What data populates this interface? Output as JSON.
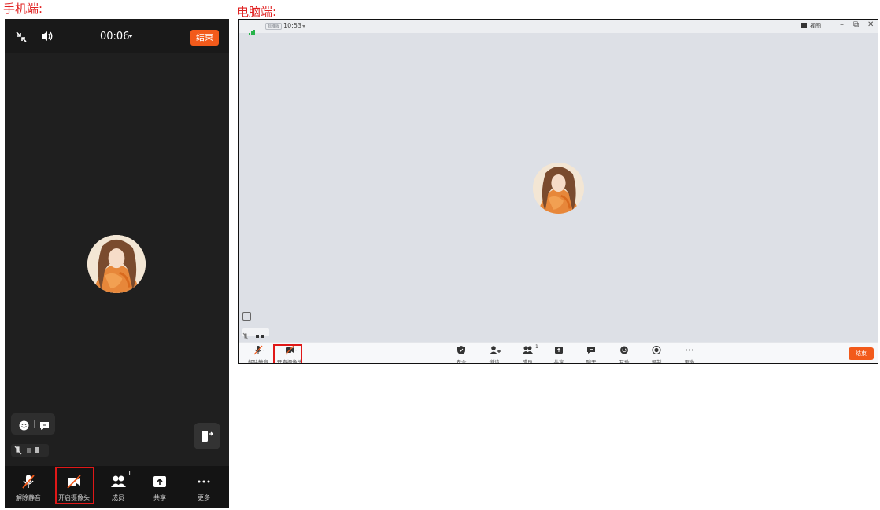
{
  "labels": {
    "mobile": "手机端:",
    "pc": "电脑端:"
  },
  "mobile": {
    "timer": "00:06",
    "end_button": "结束",
    "toolbar": [
      {
        "icon": "mic-muted-icon",
        "label": "解除静音"
      },
      {
        "icon": "camera-off-icon",
        "label": "开启摄像头",
        "highlighted": true
      },
      {
        "icon": "members-icon",
        "label": "成员",
        "badge": "1"
      },
      {
        "icon": "share-icon",
        "label": "共享"
      },
      {
        "icon": "more-icon",
        "label": "更多"
      }
    ]
  },
  "pc": {
    "badge": "标准版",
    "time": "10:53",
    "view_label": "视图",
    "end_button": "结束",
    "toolbar_left": [
      {
        "icon": "mic-muted-icon",
        "label": "解除静音"
      },
      {
        "icon": "camera-off-icon",
        "label": "开启摄像头",
        "highlighted": true
      }
    ],
    "toolbar_center": [
      {
        "icon": "security-icon",
        "label": "安全"
      },
      {
        "icon": "invite-icon",
        "label": "邀请"
      },
      {
        "icon": "members-icon",
        "label": "成员",
        "badge": "1"
      },
      {
        "icon": "share-icon",
        "label": "共享"
      },
      {
        "icon": "chat-icon",
        "label": "聊天"
      },
      {
        "icon": "interact-icon",
        "label": "互动"
      },
      {
        "icon": "record-icon",
        "label": "录制"
      },
      {
        "icon": "more-icon",
        "label": "更多"
      }
    ]
  },
  "colors": {
    "accent": "#f25a1b",
    "highlight": "#e01818",
    "mobile_bg": "#1f1f1f",
    "pc_bg": "#dde0e6"
  }
}
